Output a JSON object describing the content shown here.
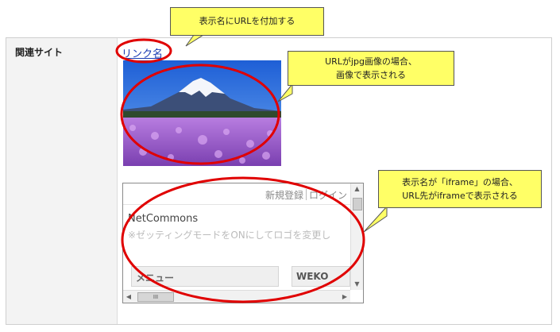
{
  "row": {
    "label": "関連サイト",
    "link_text": "リンク名"
  },
  "iframe_preview": {
    "top_links": [
      "新規登録",
      "ログイン"
    ],
    "site_name": "NetCommons",
    "hint": "※ゼッティングモードをONにしてロゴを変更し",
    "menu_label": "メニュー",
    "weko_label": "WEKO",
    "scroll_thumb_label": "III"
  },
  "callouts": {
    "top": "表示名にURLを付加する",
    "middle_line1": "URLがjpg画像の場合、",
    "middle_line2": "画像で表示される",
    "bottom_line1": "表示名が「iframe」の場合、",
    "bottom_line2": "URL先がiframeで表示される"
  },
  "colors": {
    "callout_fill": "#ffff66",
    "highlight_ellipse": "#e00000",
    "link": "#1a3bb3"
  }
}
